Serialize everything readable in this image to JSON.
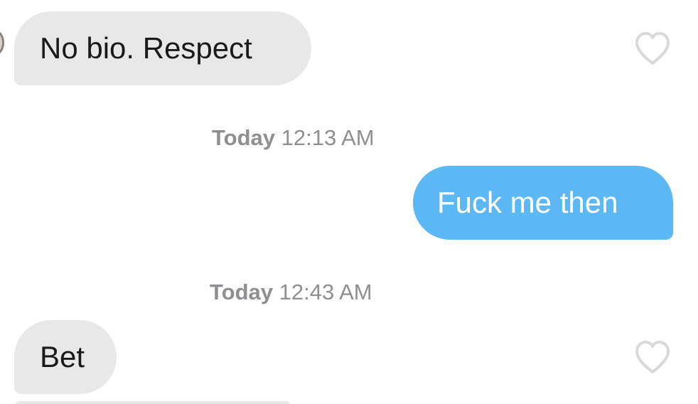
{
  "messages": [
    {
      "direction": "incoming",
      "text": "No bio. Respect"
    },
    {
      "direction": "outgoing",
      "text": "Fuck me then"
    },
    {
      "direction": "incoming",
      "text": "Bet"
    }
  ],
  "timestamps": [
    {
      "day": "Today",
      "time": "12:13 AM"
    },
    {
      "day": "Today",
      "time": "12:43 AM"
    }
  ],
  "icons": {
    "like": "heart-outline-icon"
  },
  "colors": {
    "incoming_bubble": "#e8e8e8",
    "outgoing_bubble": "#5bb8f5",
    "timestamp_text": "#8e8e93",
    "heart_outline": "#d9d9dd"
  }
}
